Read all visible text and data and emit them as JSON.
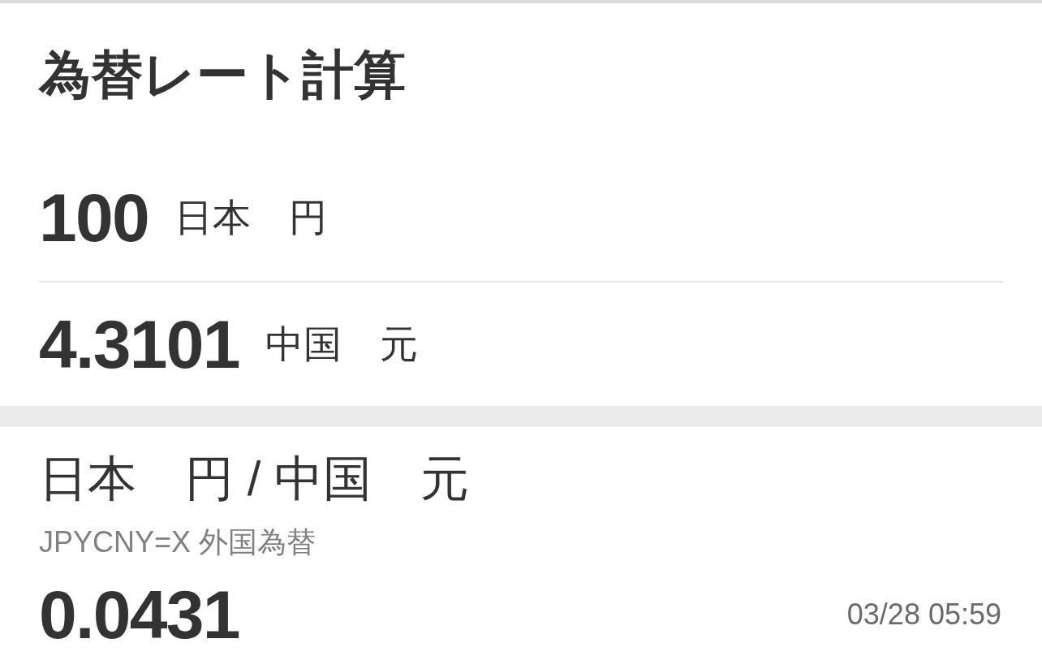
{
  "calculator": {
    "title": "為替レート計算",
    "rows": [
      {
        "amount": "100",
        "currency": "日本　円"
      },
      {
        "amount": "4.3101",
        "currency": "中国　元"
      }
    ]
  },
  "quote": {
    "pair": "日本　円 / 中国　元",
    "symbol": "JPYCNY=X 外国為替",
    "rate": "0.0431",
    "timestamp": "03/28 05:59"
  }
}
